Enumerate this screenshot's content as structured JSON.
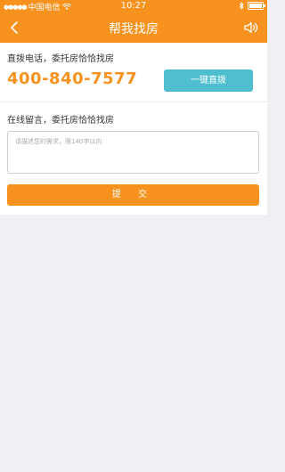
{
  "status_bar": {
    "carrier": "中国电信",
    "time": "10:27"
  },
  "nav": {
    "title": "帮我找房"
  },
  "call_section": {
    "label": "直拨电话，委托房恰恰找房",
    "phone": "400-840-7577",
    "button_label": "一键直拨"
  },
  "message_section": {
    "label": "在线留言，委托房恰恰找房",
    "placeholder": "请描述您的需求，限140字以内",
    "value": ""
  },
  "submit": {
    "label": "提 交"
  },
  "colors": {
    "brand_orange": "#f7921e",
    "call_button": "#4fbfcf",
    "background": "#efeff4"
  },
  "icons": {
    "back": "chevron-left-icon",
    "speaker": "speaker-icon",
    "wifi": "wifi-icon",
    "bluetooth": "bluetooth-icon",
    "battery": "battery-icon"
  }
}
